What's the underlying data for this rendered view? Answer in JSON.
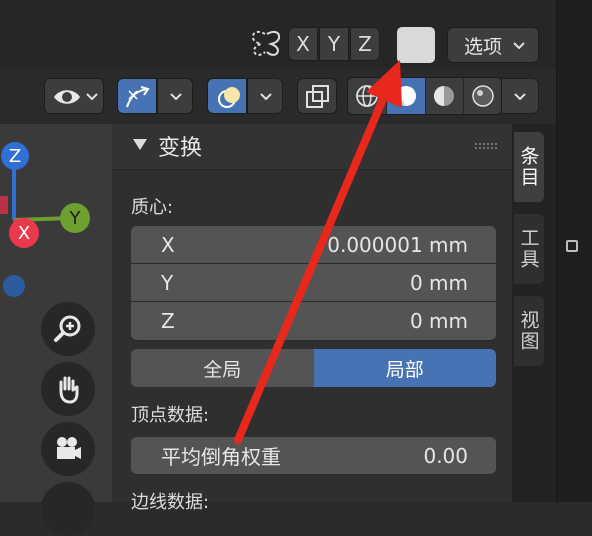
{
  "header": {
    "axes": [
      "X",
      "Y",
      "Z"
    ],
    "options_label": "选项",
    "options_icon": "chevron-down-icon",
    "swatch_color": "#d9d9d9"
  },
  "toolbar": {
    "accent": "#4772b3",
    "shading_modes": [
      "wireframe-sphere-icon",
      "solid-sphere-icon",
      "material-sphere-icon",
      "rendered-sphere-icon"
    ]
  },
  "gizmo": {
    "axes": [
      {
        "label": "Z",
        "color": "#2f6fd6"
      },
      {
        "label": "Y",
        "color": "#6da02f"
      },
      {
        "label": "X",
        "color": "#e8394d"
      }
    ]
  },
  "panel": {
    "title": "变换",
    "centroid_label": "质心:",
    "fields": [
      {
        "axis": "X",
        "value": "0.000001 mm"
      },
      {
        "axis": "Y",
        "value": "0 mm"
      },
      {
        "axis": "Z",
        "value": "0 mm"
      }
    ],
    "toggle": {
      "global": "全局",
      "local": "局部",
      "active": "local"
    },
    "vertex_data_label": "顶点数据:",
    "bevel_weight": {
      "label": "平均倒角权重",
      "value": "0.00"
    },
    "edge_data_label": "边线数据:"
  },
  "tabs": [
    "条目",
    "工具",
    "视图"
  ],
  "annotation_color": "#e8281c"
}
